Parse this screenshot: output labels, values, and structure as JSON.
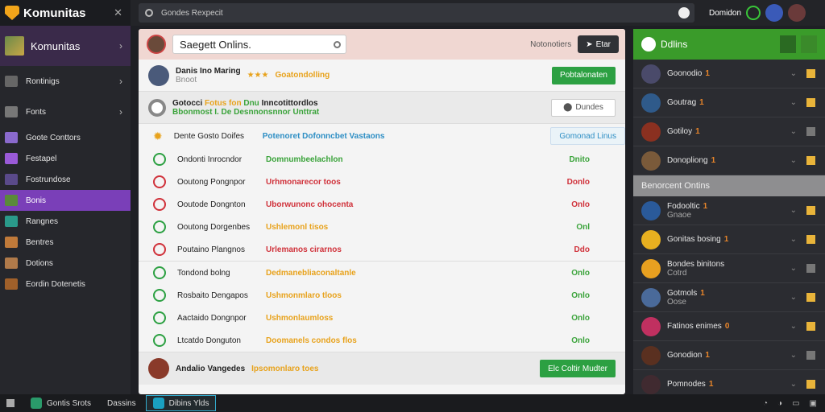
{
  "app": {
    "title": "Komunitas",
    "close_glyph": "✕"
  },
  "topbar": {
    "search_placeholder": "Gondes Rexpecit",
    "username": "Domidon",
    "icons": [
      "search-icon",
      "shield-icon",
      "status-ring-icon"
    ]
  },
  "sidebar": {
    "header": "Komunitas",
    "items": [
      {
        "label": "Rontinigs",
        "chevron": true
      },
      {
        "label": "Fonts",
        "chevron": true
      },
      {
        "label": "Goote Conttors"
      },
      {
        "label": "Festapel"
      },
      {
        "label": "Fostrundose"
      },
      {
        "label": "Bonis"
      },
      {
        "label": "Rangnes"
      },
      {
        "label": "Bentres"
      },
      {
        "label": "Dotions"
      },
      {
        "label": "Eordin Dotenetis"
      }
    ],
    "active_index": 5
  },
  "main": {
    "search_value": "Saegett Onlins.",
    "header_note": "Notonotiers",
    "header_button": "Etar",
    "profile": {
      "name": "Danis Ino Maring",
      "sub": "Bnoot",
      "tag": "Goatondolling",
      "button": "Pobtalonaten"
    },
    "invite": {
      "line1_a": "Gotocci",
      "line1_b": "Fotus fon",
      "line1_c": "Dnu",
      "line1_d": "Inncotittordlos",
      "line2": "Bbonmost I. De Desnnonsnnor Unttrat",
      "button": "Dundes"
    },
    "section_title": "Dente Gosto Doifes",
    "section_status": "Potenoret Dofonncbet Vastaons",
    "section_button": "Gomonad Linus",
    "tasks": [
      {
        "task": "Ondonti Inrocndor",
        "status": "Domnumbeelachlon",
        "status_color": "green",
        "right": "Dnito"
      },
      {
        "task": "Ooutong Pongnpor",
        "status": "Urhmonarecor toos",
        "status_color": "red",
        "right": "Donlo"
      },
      {
        "task": "Ooutode Dongnton",
        "status": "Uborwunonc ohocenta",
        "status_color": "red",
        "right": "Onlo"
      },
      {
        "task": "Ooutong Dorgenbes",
        "status": "Ushlemonl tisos",
        "status_color": "orange",
        "right": "Onl"
      },
      {
        "task": "Poutaino Plangnos",
        "status": "Urlemanos cirarnos",
        "status_color": "red",
        "right": "Ddo"
      }
    ],
    "tasks2": [
      {
        "task": "Tondond bolng",
        "status": "Dedmanebliaconaltanle",
        "status_color": "orange",
        "right": "Onlo"
      },
      {
        "task": "Rosbaito Dengapos",
        "status": "Ushmonmlaro tloos",
        "status_color": "orange",
        "right": "Onlo"
      },
      {
        "task": "Aactaido Dongnpor",
        "status": "Ushmonlaumloss",
        "status_color": "orange",
        "right": "Onlo"
      },
      {
        "task": "Ltcatdo Donguton",
        "status": "Doomanels condos flos",
        "status_color": "orange",
        "right": "Onlo"
      }
    ],
    "footer": {
      "task": "Andalio Vangedes",
      "status": "Ipsomonlaro toes",
      "button": "Elc Coltir Mudter"
    }
  },
  "right_panel": {
    "title": "Ddlins",
    "users": [
      {
        "name": "Goonodio",
        "num": "1",
        "color": "#4a4a6a"
      },
      {
        "name": "Goutrag",
        "num": "1",
        "color": "#2f5a8a"
      },
      {
        "name": "Gotiloy",
        "num": "1",
        "color": "#8a3020"
      },
      {
        "name": "Donopliong",
        "num": "1",
        "color": "#7a5a3a"
      }
    ],
    "section": "Benorcent Ontins",
    "users2": [
      {
        "name": "Fodooltic",
        "sub": "Gnaoe",
        "num": "1",
        "color": "#2a5a9a"
      },
      {
        "name": "Gonitas bosing",
        "num": "1",
        "color": "#e8b020"
      },
      {
        "name": "Bondes binitons",
        "sub": "Cotrd",
        "num": "",
        "color": "#e8a020"
      },
      {
        "name": "Gotmols",
        "sub": "Oose",
        "num": "1",
        "color": "#4a6a9a"
      },
      {
        "name": "Fatinos enimes",
        "num": "0",
        "color": "#c03060"
      },
      {
        "name": "Gonodion",
        "num": "1",
        "color": "#5a3020"
      },
      {
        "name": "Pomnodes",
        "num": "1",
        "color": "#402a30"
      }
    ]
  },
  "taskbar": {
    "apps": [
      {
        "label": "Gontis Srots"
      },
      {
        "label": "Dassins"
      },
      {
        "label": "Dibins Ylds"
      }
    ]
  }
}
